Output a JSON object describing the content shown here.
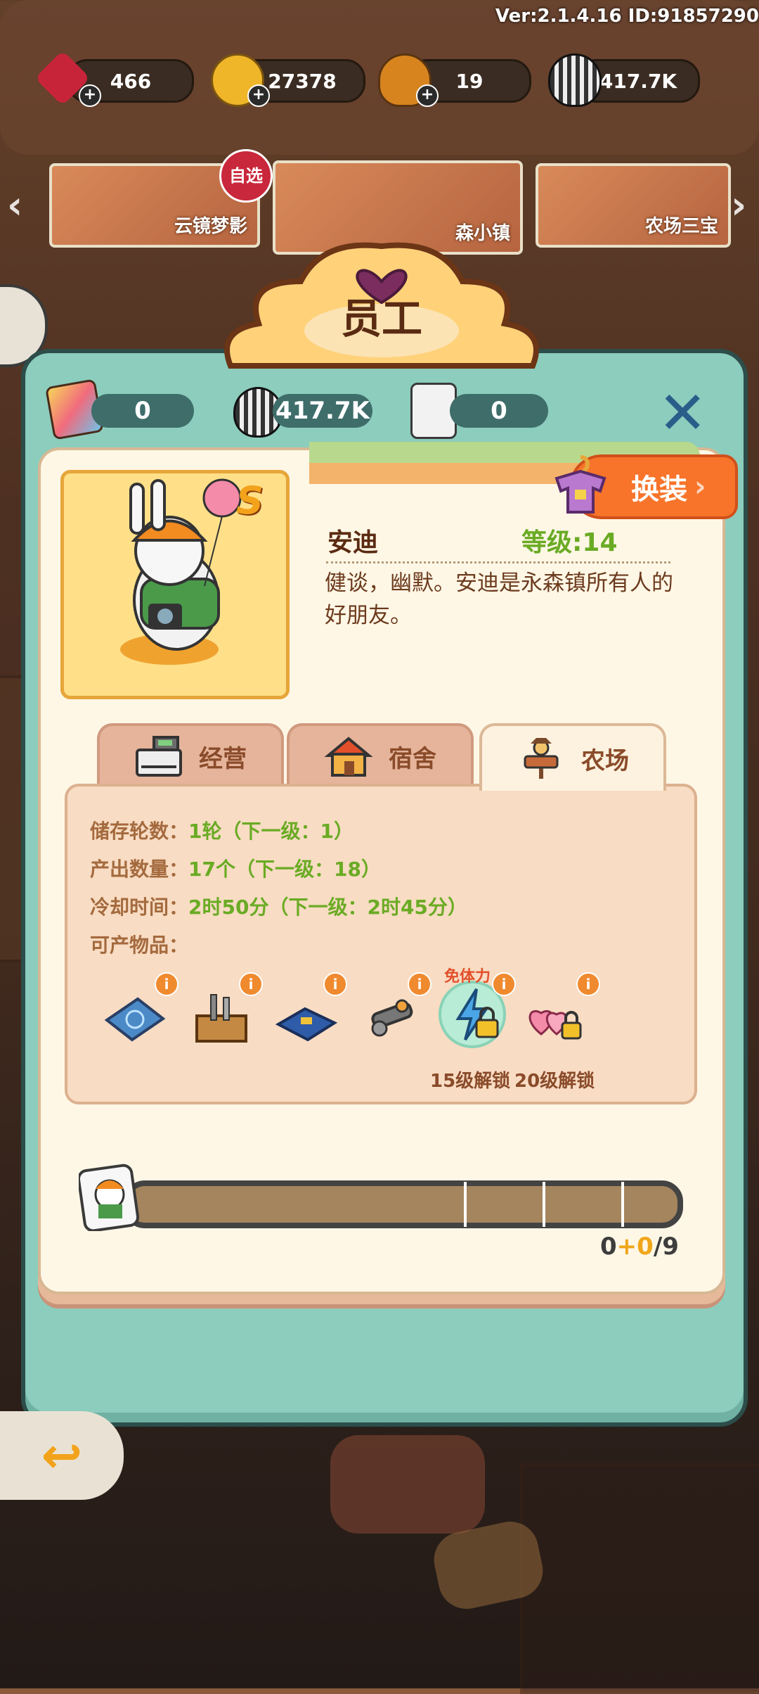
{
  "version_text": "Ver:2.1.4.16 ID:91857290",
  "resources": [
    {
      "name": "gems",
      "value": "466"
    },
    {
      "name": "coins",
      "value": "27378"
    },
    {
      "name": "acorns",
      "value": "19"
    },
    {
      "name": "seeds",
      "value": "417.7K"
    }
  ],
  "banners": {
    "left_label": "云镜梦影",
    "left_badge": "自选",
    "center_label": "森小镇",
    "right_label": "农场三宝"
  },
  "panel": {
    "title": "员工",
    "stats": [
      {
        "icon": "puzzle-icon",
        "value": "0"
      },
      {
        "icon": "sunflower-seed-icon",
        "value": "417.7K"
      },
      {
        "icon": "bunny-card-icon",
        "value": "0"
      }
    ],
    "dress_button": "换装"
  },
  "character": {
    "rank": "S",
    "name": "安迪",
    "level": "等级:14",
    "description": "健谈，幽默。安迪是永森镇所有人的好朋友。"
  },
  "tabs": [
    {
      "label": "经营",
      "icon": "cash-register-icon"
    },
    {
      "label": "宿舍",
      "icon": "house-icon"
    },
    {
      "label": "农场",
      "icon": "scarecrow-icon"
    }
  ],
  "active_tab": "农场",
  "farm_info": {
    "storage_label": "储存轮数：",
    "storage_value": "1轮（下一级：1）",
    "output_label": "产出数量：",
    "output_value": "17个（下一级：18）",
    "cooldown_label": "冷却时间：",
    "cooldown_value": "2时50分（下一级：2时45分）",
    "items_label": "可产物品：",
    "free_stamina_tag": "免体力",
    "unlock_15": "15级解锁",
    "unlock_20": "20级解锁"
  },
  "items": [
    {
      "icon": "blueprint-icon",
      "locked": false
    },
    {
      "icon": "toolbox-icon",
      "locked": false
    },
    {
      "icon": "circuit-board-icon",
      "locked": false
    },
    {
      "icon": "gears-icon",
      "locked": false
    },
    {
      "icon": "energy-bolt-icon",
      "locked": true
    },
    {
      "icon": "hearts-icon",
      "locked": true
    }
  ],
  "progress": {
    "current": "0",
    "bonus": "+0",
    "total": "/9",
    "fraction": 0
  },
  "colors": {
    "panel": "#8ccdbd",
    "card": "#fff7e6",
    "accent_orange": "#f7742a",
    "level_green": "#6aab24"
  }
}
